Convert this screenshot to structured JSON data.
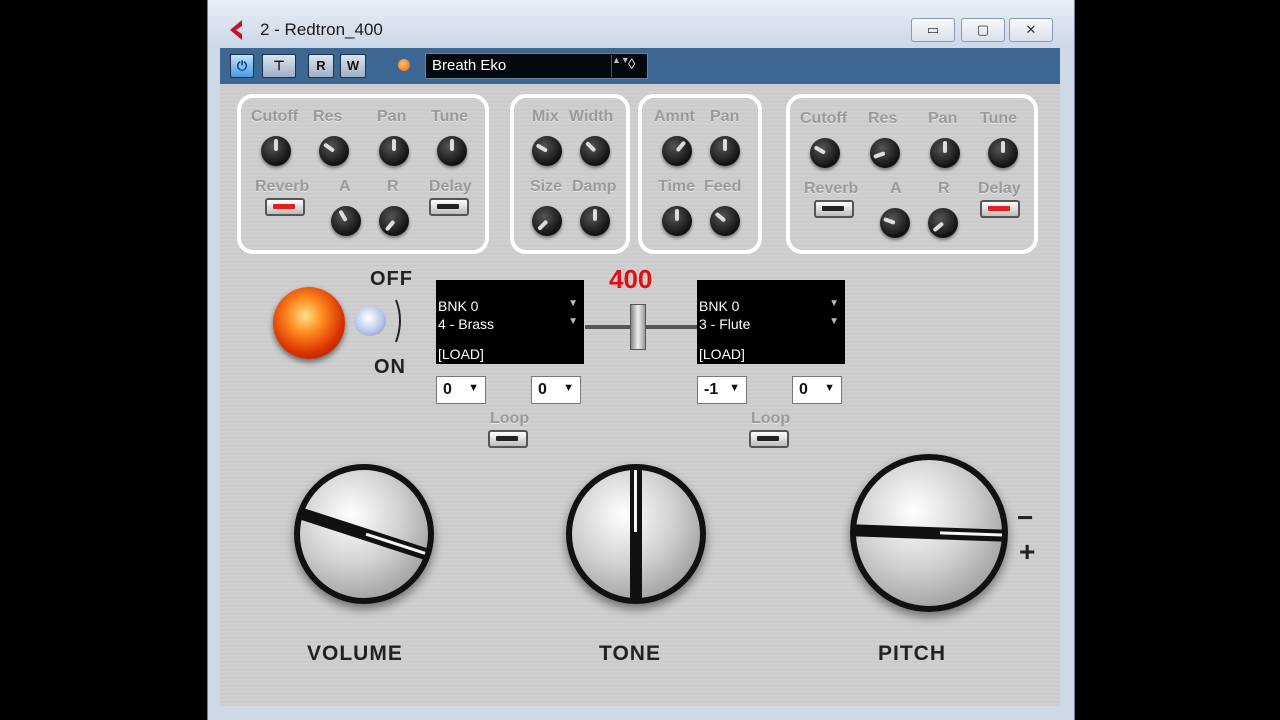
{
  "window": {
    "title": "2 - Redtron_400",
    "buttons": {
      "minimize": "▭",
      "maximize": "▢",
      "close": "✕"
    }
  },
  "toolbar": {
    "power_label": "⏻",
    "monitor_label": "⊤",
    "read_label": "R",
    "write_label": "W",
    "preset_name": "Breath Eko",
    "preset_arrows": "▲▼",
    "preset_menu": "◊"
  },
  "filter_left": {
    "cutoff": "Cutoff",
    "res": "Res",
    "pan": "Pan",
    "tune": "Tune",
    "reverb": "Reverb",
    "a": "A",
    "r": "R",
    "delay": "Delay"
  },
  "reverb_group": {
    "mix": "Mix",
    "width": "Width",
    "size": "Size",
    "damp": "Damp"
  },
  "delay_group": {
    "amnt": "Amnt",
    "pan": "Pan",
    "time": "Time",
    "feed": "Feed"
  },
  "filter_right": {
    "cutoff": "Cutoff",
    "res": "Res",
    "pan": "Pan",
    "tune": "Tune",
    "reverb": "Reverb",
    "a": "A",
    "r": "R",
    "delay": "Delay"
  },
  "power_switch": {
    "off": "OFF",
    "on": "ON"
  },
  "crossfade": {
    "value": "400"
  },
  "bank_left": {
    "bank": "BNK  0",
    "sound": "4 - Brass",
    "load": "[LOAD]",
    "sel1": "0",
    "sel2": "0",
    "loop": "Loop"
  },
  "bank_right": {
    "bank": "BNK  0",
    "sound": "3 - Flute",
    "load": "[LOAD]",
    "sel1": "-1",
    "sel2": "0",
    "loop": "Loop"
  },
  "main": {
    "volume": "VOLUME",
    "tone": "TONE",
    "pitch": "PITCH",
    "minus": "−",
    "plus": "+"
  }
}
